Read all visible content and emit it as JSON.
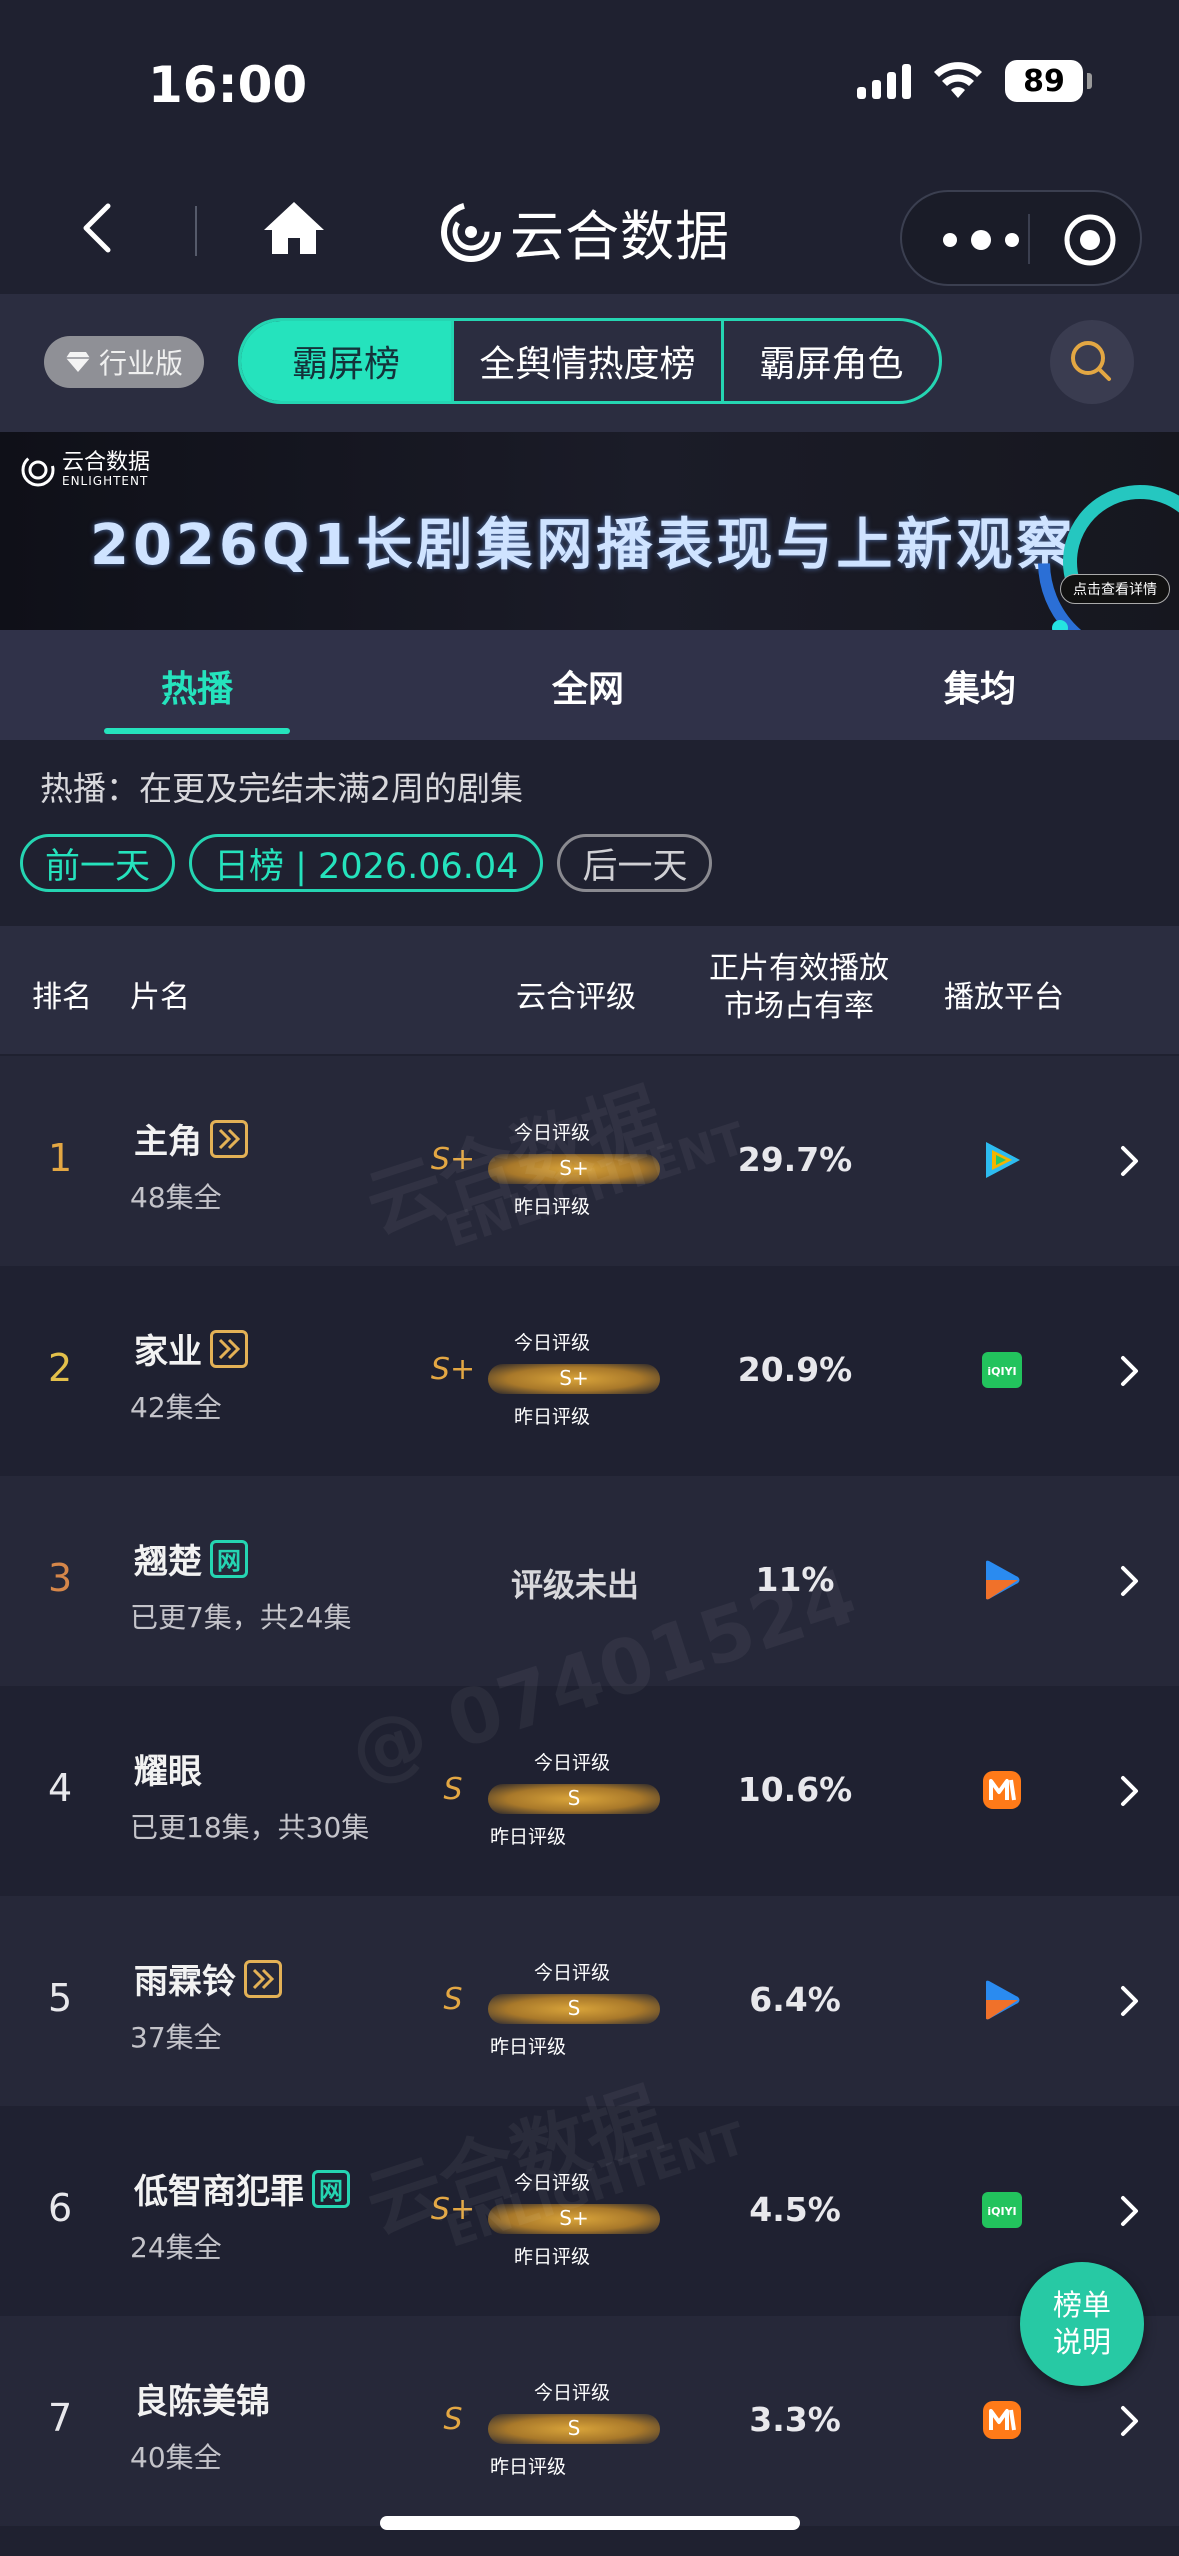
{
  "status_bar": {
    "time": "16:00",
    "battery": "89"
  },
  "navbar": {
    "title": "云合数据"
  },
  "tabrow": {
    "industry_badge": "行业版",
    "tabs": [
      {
        "label": "霸屏榜",
        "active": true
      },
      {
        "label": "全舆情热度榜",
        "active": false
      },
      {
        "label": "霸屏角色",
        "active": false
      }
    ]
  },
  "banner": {
    "logo_text": "云合数据",
    "logo_sub": "ENLIGHTENT",
    "title": "2026Q1长剧集网播表现与上新观察",
    "cta": "点击查看详情"
  },
  "subtabs": [
    {
      "label": "热播",
      "active": true
    },
    {
      "label": "全网",
      "active": false
    },
    {
      "label": "集均",
      "active": false
    }
  ],
  "description": "热播：在更及完结未满2周的剧集",
  "date_nav": {
    "prev": "前一天",
    "current": "日榜 | 2026.06.04",
    "next": "后一天"
  },
  "table_header": {
    "rank": "排名",
    "name": "片名",
    "rating": "云合评级",
    "share_line1": "正片有效播放",
    "share_line2": "市场占有率",
    "platform": "播放平台"
  },
  "meter_labels": {
    "today": "今日评级",
    "yesterday": "昨日评级"
  },
  "rows": [
    {
      "rank": "1",
      "name": "主角",
      "tag": "独",
      "episodes": "48集全",
      "grade": "S+",
      "bar": "S+",
      "share": "29.7%",
      "platform": "tencent-video"
    },
    {
      "rank": "2",
      "name": "家业",
      "tag": "独",
      "episodes": "42集全",
      "grade": "S+",
      "bar": "S+",
      "share": "20.9%",
      "platform": "iqiyi"
    },
    {
      "rank": "3",
      "name": "翘楚",
      "tag": "网",
      "episodes": "已更7集，共24集",
      "no_grade": "评级未出",
      "share": "11%",
      "platform": "youku"
    },
    {
      "rank": "4",
      "name": "耀眼",
      "tag": "",
      "episodes": "已更18集，共30集",
      "grade": "S",
      "bar": "S",
      "share": "10.6%",
      "platform": "mango-tv"
    },
    {
      "rank": "5",
      "name": "雨霖铃",
      "tag": "独",
      "episodes": "37集全",
      "grade": "S",
      "bar": "S",
      "share": "6.4%",
      "platform": "youku"
    },
    {
      "rank": "6",
      "name": "低智商犯罪",
      "tag": "网",
      "episodes": "24集全",
      "grade": "S+",
      "bar": "S+",
      "share": "4.5%",
      "platform": "iqiyi"
    },
    {
      "rank": "7",
      "name": "良陈美锦",
      "tag": "",
      "episodes": "40集全",
      "grade": "S",
      "bar": "S",
      "share": "3.3%",
      "platform": "mango-tv"
    }
  ],
  "fab": {
    "line1": "榜单",
    "line2": "说明"
  },
  "watermarks": {
    "brand": "云合数据",
    "brand_en": "ENLIGHTENT",
    "user_id": "@ 07401524"
  },
  "colors": {
    "accent": "#25e3bd",
    "gold": "#e3a743",
    "background": "#1f2130"
  }
}
